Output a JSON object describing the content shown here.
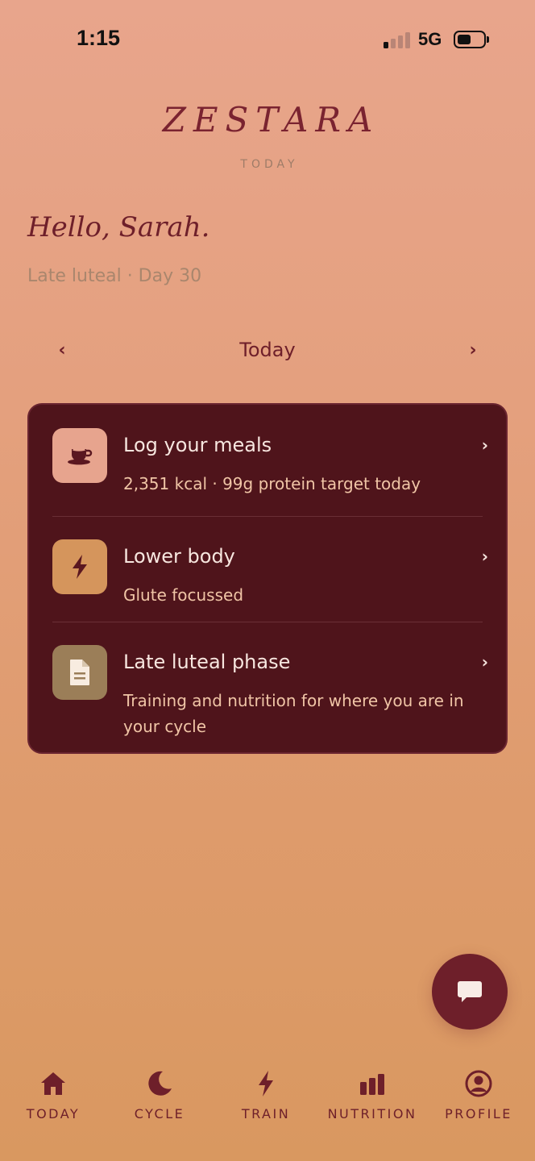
{
  "status_bar": {
    "time": "1:15",
    "network": "5G"
  },
  "header": {
    "brand": "ZESTARA",
    "subtitle": "TODAY"
  },
  "greeting": {
    "hello": "Hello, Sarah.",
    "phase_line": "Late luteal · Day 30"
  },
  "date_nav": {
    "label": "Today",
    "prev": "‹",
    "next": "›"
  },
  "card": {
    "rows": [
      {
        "icon": "tea-cup-icon",
        "title": "Log your meals",
        "subtitle": "2,351 kcal · 99g protein target today",
        "chevron": "›"
      },
      {
        "icon": "lightning-icon",
        "title": "Lower body",
        "subtitle": "Glute focussed",
        "chevron": "›"
      },
      {
        "icon": "document-icon",
        "title": "Late luteal phase",
        "subtitle": "Training and nutrition for where you are in your cycle",
        "chevron": "›"
      }
    ]
  },
  "fab": {
    "icon": "chat-bubble-icon"
  },
  "tabs": [
    {
      "label": "TODAY",
      "icon": "home-icon"
    },
    {
      "label": "CYCLE",
      "icon": "moon-icon"
    },
    {
      "label": "TRAIN",
      "icon": "lightning-icon"
    },
    {
      "label": "NUTRITION",
      "icon": "bar-chart-icon"
    },
    {
      "label": "PROFILE",
      "icon": "user-circle-icon"
    }
  ],
  "colors": {
    "accent": "#6e1f2a",
    "card_bg": "#4f141b",
    "meal_icon_bg": "#e7a48e",
    "train_icon_bg": "#d5955c",
    "phase_icon_bg": "#9b7e58"
  }
}
